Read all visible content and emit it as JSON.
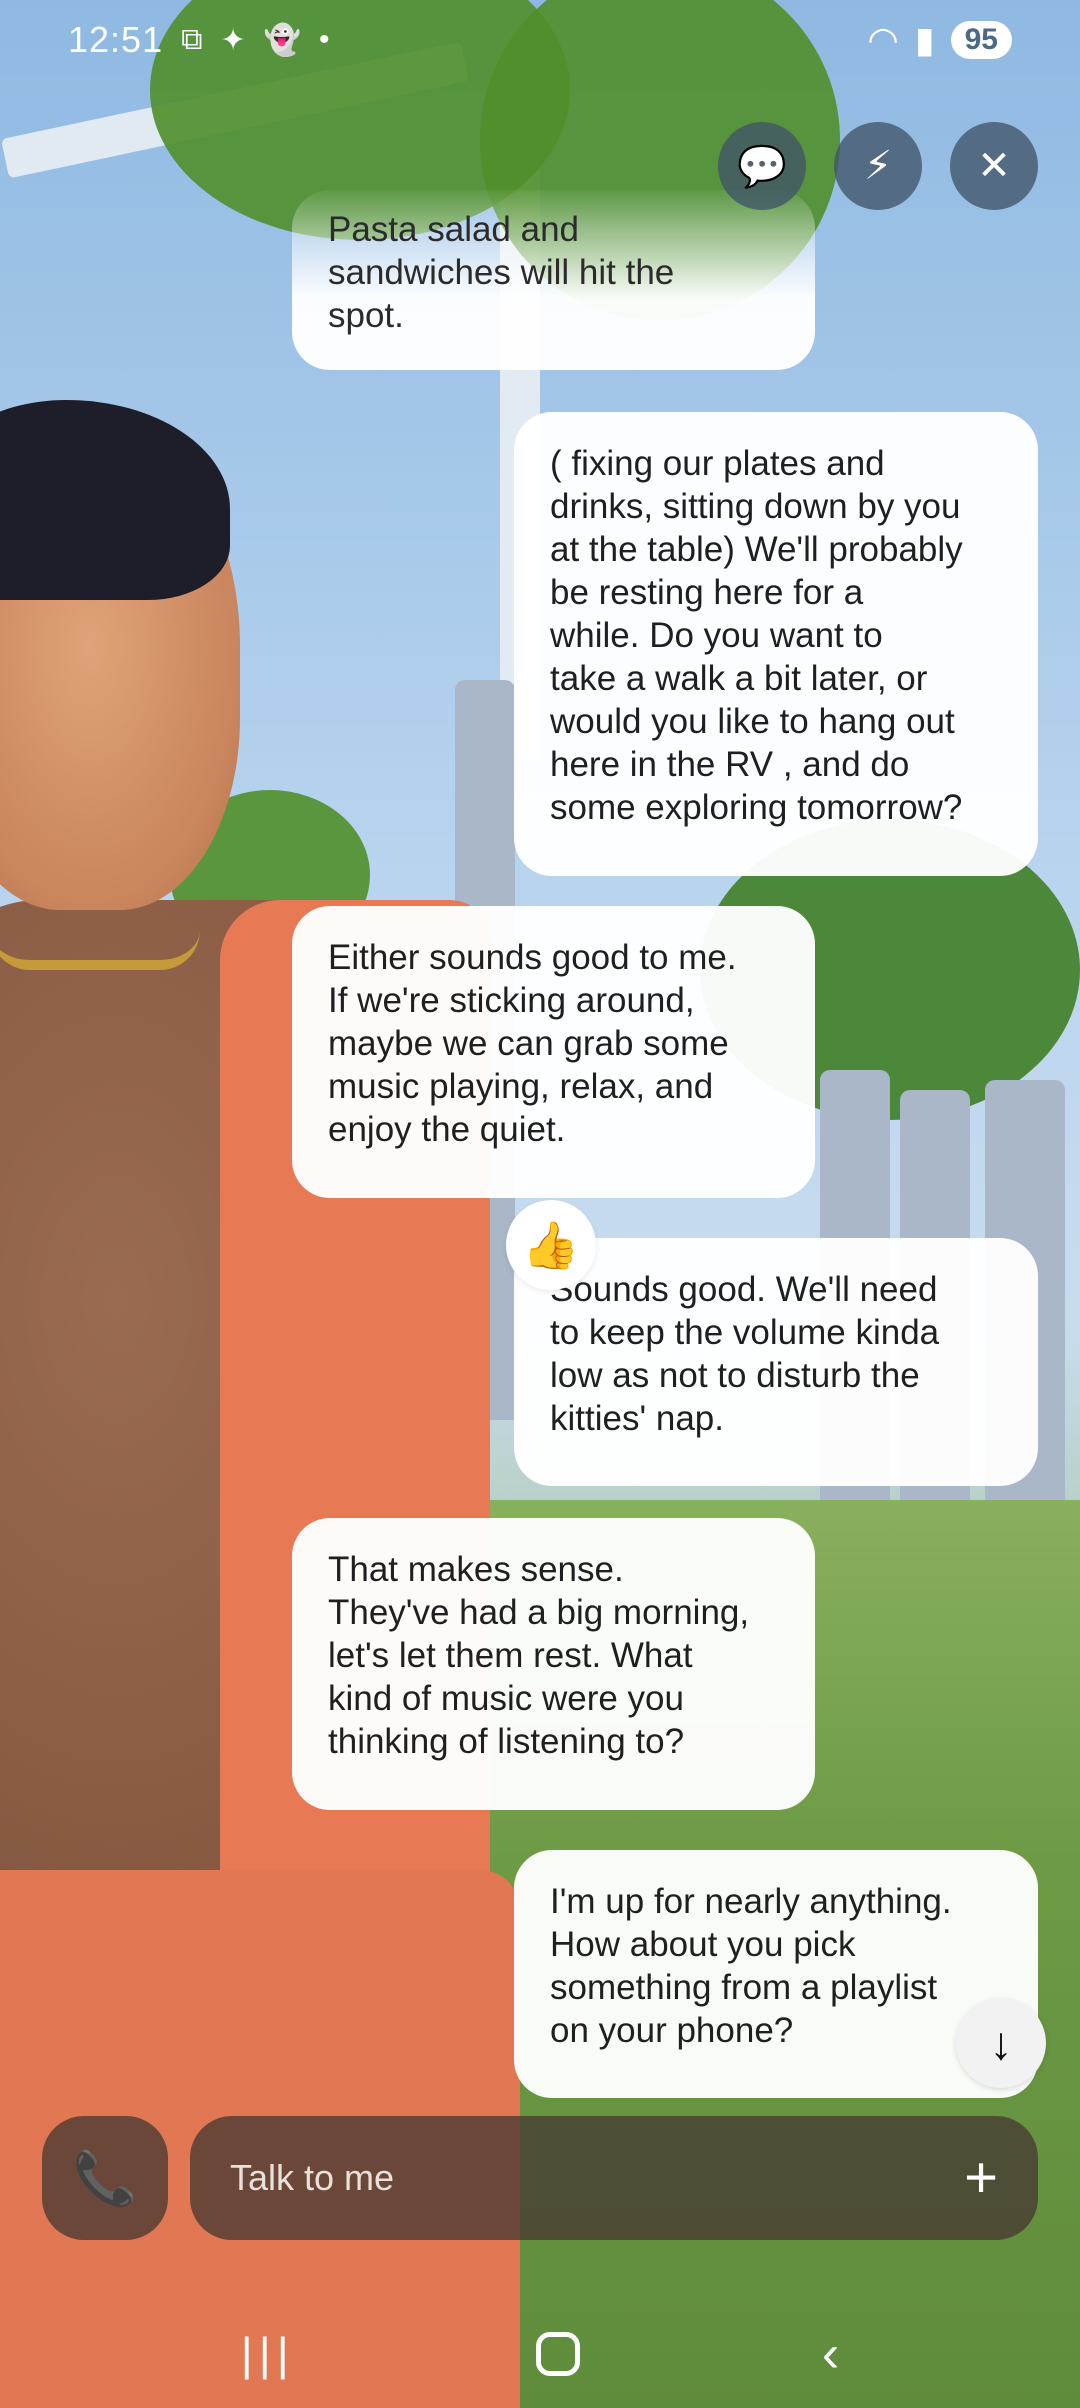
{
  "status_bar": {
    "time": "12:51",
    "battery": "95",
    "left_icons": [
      "screen-record-icon",
      "sparkle-icon",
      "snapchat-icon",
      "dot-icon"
    ],
    "right_icons": [
      "wifi-icon",
      "signal-icon"
    ]
  },
  "top_controls": [
    {
      "name": "chat-mode-button",
      "icon": "chat-bubble-dots-icon",
      "glyph": "💬"
    },
    {
      "name": "quick-reply-button",
      "icon": "chat-bolt-icon",
      "glyph": "⚡"
    },
    {
      "name": "close-button",
      "icon": "close-icon",
      "glyph": "✕"
    }
  ],
  "messages": [
    {
      "role": "bot",
      "text": "Pasta salad and\nsandwiches will hit the\nspot.",
      "faded": true
    },
    {
      "role": "user",
      "text": "( fixing our plates and\ndrinks, sitting down by you\nat the table) We'll probably\nbe resting  here for a\nwhile.  Do you want to\ntake a walk a bit later, or\nwould you like to hang out\nhere in the RV , and do\nsome exploring tomorrow?"
    },
    {
      "role": "bot",
      "text": "Either sounds good to me.\nIf we're sticking around,\nmaybe we can grab some\nmusic playing, relax, and\nenjoy the quiet."
    },
    {
      "role": "user",
      "text": "Sounds good.  We'll need\nto keep the volume  kinda\nlow as not to disturb the\nkitties' nap.",
      "reaction": "👍"
    },
    {
      "role": "bot",
      "text": "That makes sense.\nThey've had a big morning,\nlet's let them rest. What\nkind of music were you\nthinking of listening to?"
    },
    {
      "role": "user",
      "text": "I'm up for nearly anything.\nHow about you pick\nsomething from a playlist\non your phone?"
    }
  ],
  "reaction_glyph": "👍",
  "scroll_down_glyph": "↓",
  "input": {
    "placeholder": "Talk to me",
    "value": "",
    "call_glyph": "📞",
    "plus_glyph": "+"
  },
  "nav_bar": {
    "recents_glyph": "|||",
    "back_glyph": "‹"
  }
}
